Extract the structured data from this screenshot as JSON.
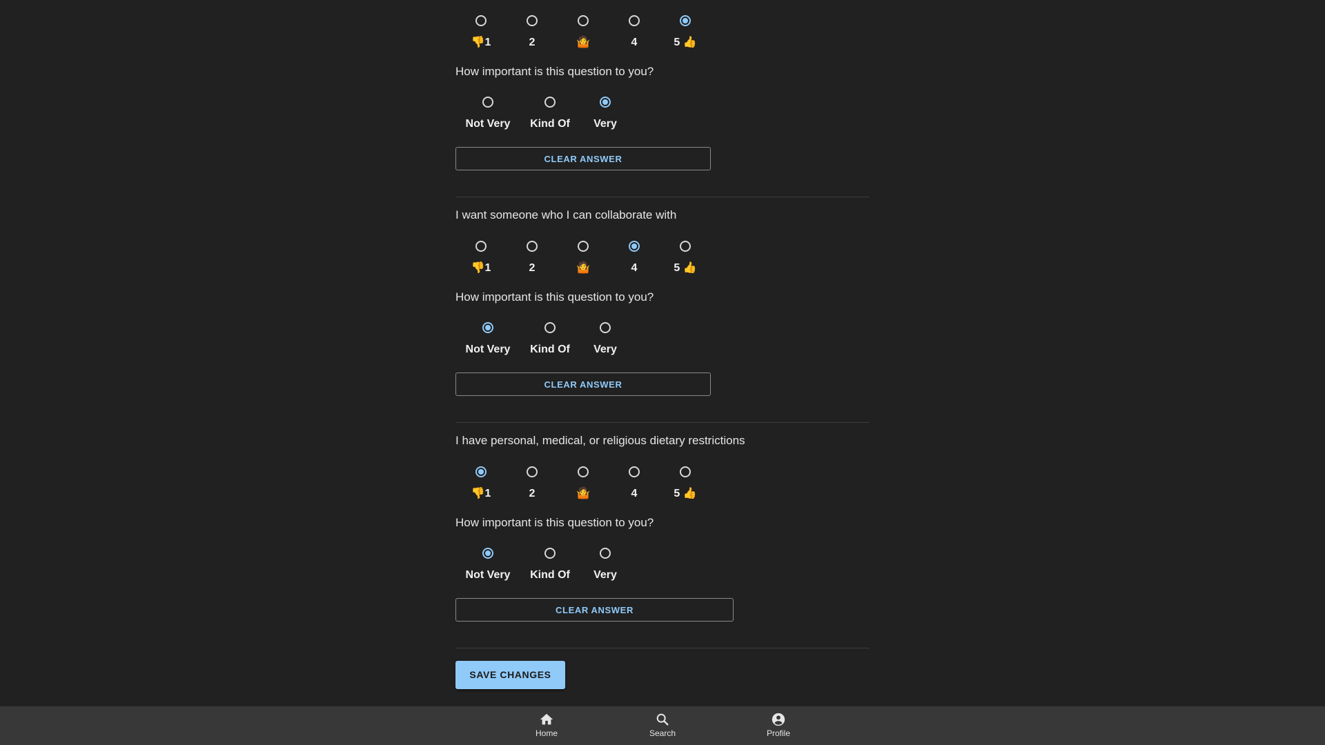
{
  "rating_labels": {
    "one": "1",
    "two": "2",
    "four": "4",
    "five": "5",
    "thumbs_down": "👎",
    "thumbs_up": "👍",
    "shrug": "🤷"
  },
  "importance_prompt": "How important is this question to you?",
  "importance_options": [
    "Not Very",
    "Kind Of",
    "Very"
  ],
  "clear_label": "CLEAR ANSWER",
  "questions": [
    {
      "title": "",
      "selected_rating": 5,
      "selected_importance": "Very"
    },
    {
      "title": "I want someone who I can collaborate with",
      "selected_rating": 4,
      "selected_importance": "Not Very"
    },
    {
      "title": "I have personal, medical, or religious dietary restrictions",
      "selected_rating": 1,
      "selected_importance": "Not Very"
    }
  ],
  "save_label": "SAVE CHANGES",
  "nav": {
    "home": "Home",
    "search": "Search",
    "profile": "Profile"
  },
  "colors": {
    "background": "#212121",
    "accent": "#90caf9",
    "nav_bar": "#383838"
  }
}
